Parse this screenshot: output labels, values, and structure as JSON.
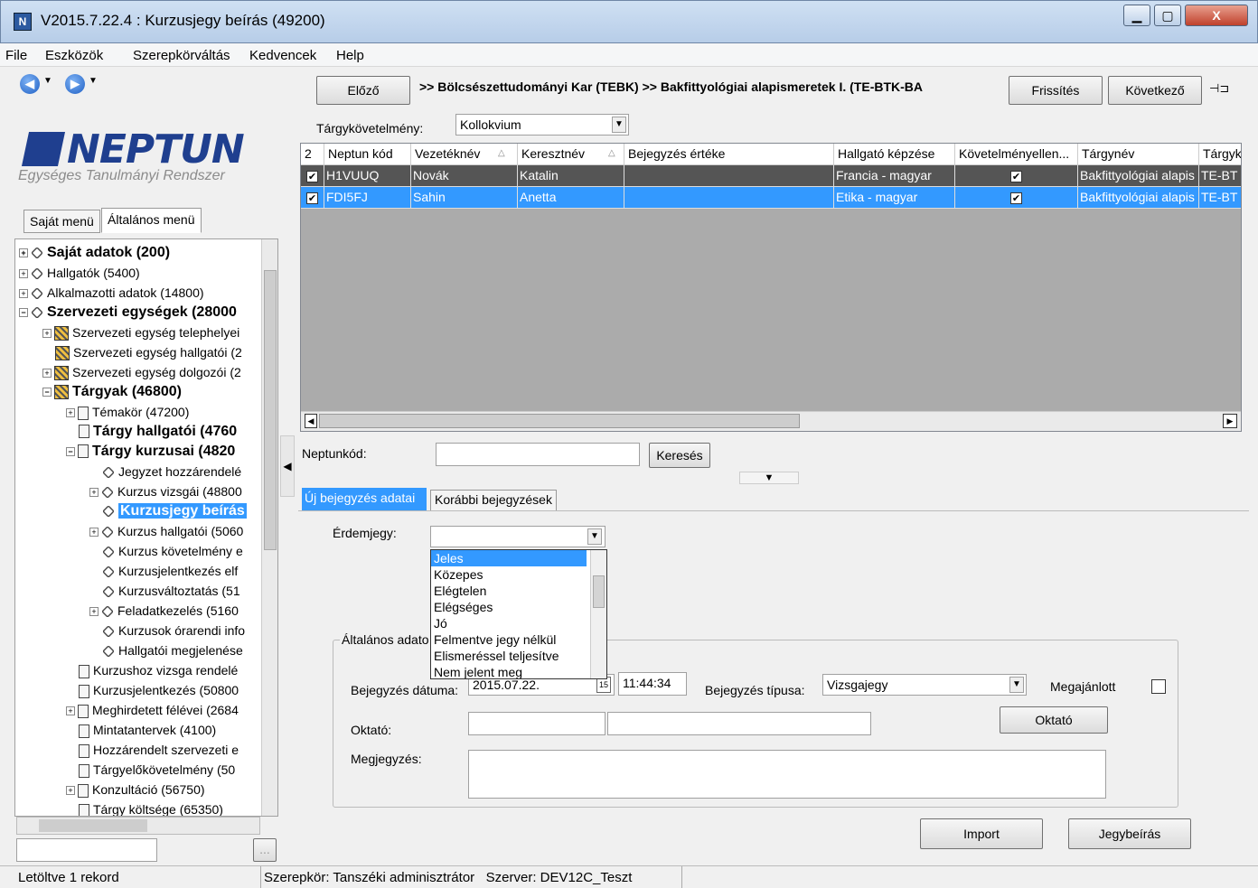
{
  "window": {
    "title": "V2015.7.22.4 : Kurzusjegy beírás (49200)",
    "minimize": "▁",
    "maximize": "▢",
    "close": "X"
  },
  "menu": [
    "File",
    "Eszközök",
    "Szerepkörváltás",
    "Kedvencek",
    "Help"
  ],
  "logo": {
    "main": "NEPTUN",
    "sub": "Egységes Tanulmányi Rendszer"
  },
  "left_tabs": [
    "Saját menü",
    "Általános menü"
  ],
  "tree": [
    {
      "label": "Saját adatok (200)"
    },
    {
      "label": "Hallgatók (5400)"
    },
    {
      "label": "Alkalmazotti adatok (14800)"
    },
    {
      "label": "Szervezeti egységek (28000"
    },
    {
      "label": "Szervezeti egység telephelyei"
    },
    {
      "label": "Szervezeti egység hallgatói (2"
    },
    {
      "label": "Szervezeti egység dolgozói (2"
    },
    {
      "label": "Tárgyak (46800)"
    },
    {
      "label": "Témakör (47200)"
    },
    {
      "label": "Tárgy hallgatói (4760"
    },
    {
      "label": "Tárgy kurzusai (4820"
    },
    {
      "label": "Jegyzet hozzárendelé"
    },
    {
      "label": "Kurzus vizsgái (48800"
    },
    {
      "label": "Kurzusjegy beírás"
    },
    {
      "label": "Kurzus hallgatói (5060"
    },
    {
      "label": "Kurzus követelmény e"
    },
    {
      "label": "Kurzusjelentkezés elf"
    },
    {
      "label": "Kurzusváltoztatás (51"
    },
    {
      "label": "Feladatkezelés (5160"
    },
    {
      "label": "Kurzusok órarendi info"
    },
    {
      "label": "Hallgatói megjelenése"
    },
    {
      "label": "Kurzushoz vizsga rendelé"
    },
    {
      "label": "Kurzusjelentkezés (50800"
    },
    {
      "label": "Meghirdetett félévei (2684"
    },
    {
      "label": "Mintatantervek (4100)"
    },
    {
      "label": "Hozzárendelt szervezeti e"
    },
    {
      "label": "Tárgyelőkövetelmény (50"
    },
    {
      "label": "Konzultáció (56750)"
    },
    {
      "label": "Tárgy költsége (65350)"
    }
  ],
  "left_bottom_btn": "...",
  "top": {
    "prev": "Előző",
    "breadcrumb": ">> Bölcsészettudományi Kar (TEBK) >> Bakfittyológiai alapismeretek I. (TE-BTK-BA",
    "refresh": "Frissítés",
    "next": "Következő",
    "pin": "⊣⊐"
  },
  "requirement": {
    "label": "Tárgykövetelmény:",
    "value": "Kollokvium"
  },
  "grid": {
    "headers": [
      "2",
      "Neptun kód",
      "Vezetéknév",
      "Keresztnév",
      "Bejegyzés értéke",
      "Hallgató képzése",
      "Követelményellen...",
      "Tárgynév",
      "Tárgyk"
    ],
    "rows": [
      {
        "code": "H1VUUQ",
        "last": "Novák",
        "first": "Katalin",
        "value": "",
        "training": "Francia - magyar",
        "course": "Bakfittyológiai alapis",
        "code2": "TE-BT"
      },
      {
        "code": "FDI5FJ",
        "last": "Sahin",
        "first": "Anetta",
        "value": "",
        "training": "Etika - magyar",
        "course": "Bakfittyológiai alapis",
        "code2": "TE-BT"
      }
    ]
  },
  "search": {
    "label": "Neptunkód:",
    "value": "",
    "button": "Keresés"
  },
  "tabs": [
    "Új bejegyzés adatai",
    "Korábbi bejegyzések"
  ],
  "grade": {
    "label": "Érdemjegy:",
    "value": "",
    "options": [
      "Jeles",
      "Közepes",
      "Elégtelen",
      "Elégséges",
      "Jó",
      "Felmentve jegy nélkül",
      "Elismeréssel teljesítve",
      "Nem jelent meg"
    ]
  },
  "general": {
    "legend": "Általános adato",
    "date_label": "Bejegyzés dátuma:",
    "date_value": "2015.07.22.",
    "calendar": "15",
    "time_value": "11:44:34",
    "type_label": "Bejegyzés típusa:",
    "type_value": "Vizsgajegy",
    "offered_label": "Megajánlott",
    "teacher_label": "Oktató:",
    "teacher_btn": "Oktató",
    "note_label": "Megjegyzés:"
  },
  "bottom": {
    "import": "Import",
    "submit": "Jegybeírás"
  },
  "status": {
    "left": "Letöltve 1 rekord",
    "mid": "Szerepkör: Tanszéki adminisztrátor   Szerver: DEV12C_Teszt"
  }
}
